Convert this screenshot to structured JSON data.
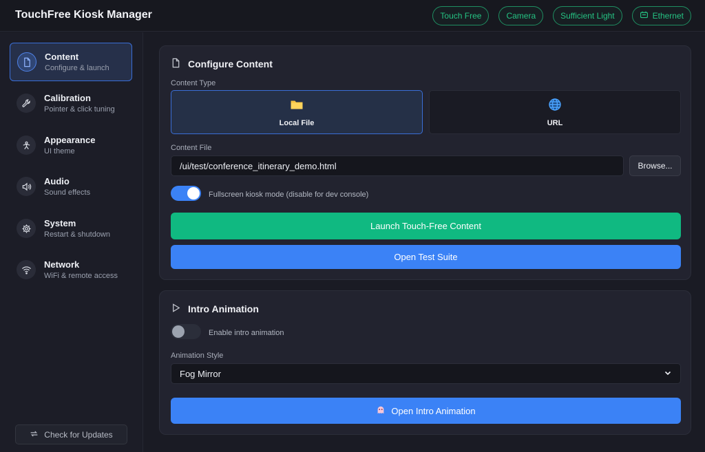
{
  "app": {
    "title": "TouchFree Kiosk Manager"
  },
  "status": [
    {
      "label": "Touch Free",
      "icon": ""
    },
    {
      "label": "Camera",
      "icon": ""
    },
    {
      "label": "Sufficient Light",
      "icon": ""
    },
    {
      "label": "Ethernet",
      "icon": "ethernet-icon"
    }
  ],
  "colors": {
    "accent": "#3b82f6",
    "success": "#10b981",
    "status_green": "#25c383"
  },
  "sidebar": {
    "items": [
      {
        "label": "Content",
        "sub": "Configure & launch",
        "icon": "document-icon",
        "active": true
      },
      {
        "label": "Calibration",
        "sub": "Pointer & click tuning",
        "icon": "wrench-icon"
      },
      {
        "label": "Appearance",
        "sub": "UI theme",
        "icon": "person-icon"
      },
      {
        "label": "Audio",
        "sub": "Sound effects",
        "icon": "speaker-icon"
      },
      {
        "label": "System",
        "sub": "Restart & shutdown",
        "icon": "gear-icon"
      },
      {
        "label": "Network",
        "sub": "WiFi & remote access",
        "icon": "wifi-icon"
      }
    ],
    "update_label": "Check for Updates"
  },
  "configure": {
    "title": "Configure Content",
    "content_type_label": "Content Type",
    "types": [
      {
        "label": "Local File",
        "icon": "folder-icon",
        "selected": true
      },
      {
        "label": "URL",
        "icon": "globe-icon",
        "selected": false
      }
    ],
    "file_label": "Content File",
    "file_value": "/ui/test/conference_itinerary_demo.html",
    "browse_label": "Browse...",
    "fullscreen_label": "Fullscreen kiosk mode (disable for dev console)",
    "fullscreen_on": true,
    "launch_label": "Launch Touch-Free Content",
    "test_label": "Open Test Suite"
  },
  "intro": {
    "title": "Intro Animation",
    "enable_label": "Enable intro animation",
    "enable_on": false,
    "style_label": "Animation Style",
    "style_value": "Fog Mirror",
    "open_label": "Open Intro Animation"
  }
}
